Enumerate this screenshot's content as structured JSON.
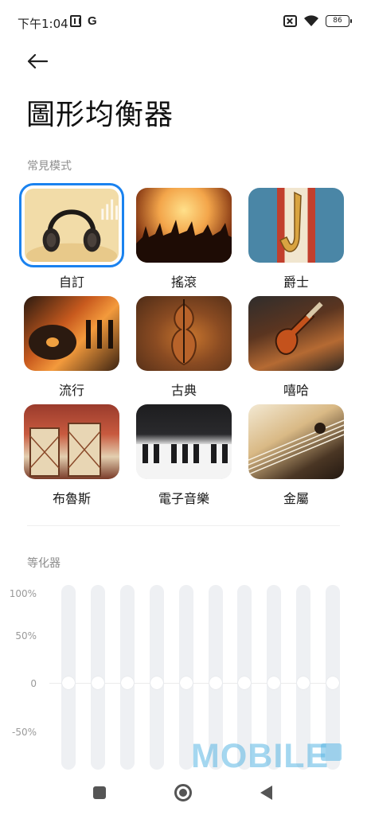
{
  "status_bar": {
    "time": "下午1:04",
    "g_label": "G",
    "battery": "86"
  },
  "page": {
    "title": "圖形均衡器"
  },
  "presets_section": {
    "title": "常見模式",
    "items": [
      {
        "label": "自訂",
        "selected": true
      },
      {
        "label": "搖滾",
        "selected": false
      },
      {
        "label": "爵士",
        "selected": false
      },
      {
        "label": "流行",
        "selected": false
      },
      {
        "label": "古典",
        "selected": false
      },
      {
        "label": "嘻哈",
        "selected": false
      },
      {
        "label": "布魯斯",
        "selected": false
      },
      {
        "label": "電子音樂",
        "selected": false
      },
      {
        "label": "金屬",
        "selected": false
      }
    ]
  },
  "equalizer": {
    "title": "等化器",
    "scale_labels": [
      "100%",
      "50%",
      "0",
      "-50%"
    ],
    "band_levels": [
      0,
      0,
      0,
      0,
      0,
      0,
      0,
      0,
      0,
      0
    ]
  },
  "watermark": "MOBILE",
  "colors": {
    "accent": "#1a82ef",
    "track": "#eef0f3",
    "watermark": "#5bb7e4"
  }
}
